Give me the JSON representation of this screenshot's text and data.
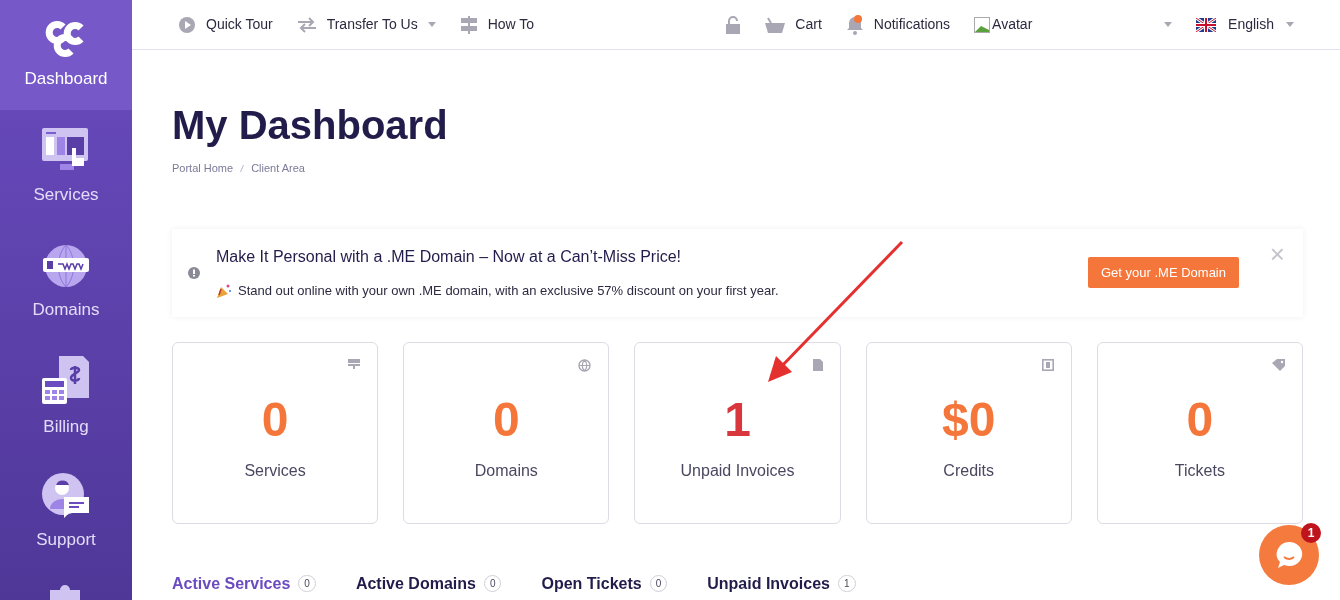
{
  "sidebar": {
    "items": [
      {
        "label": "Dashboard",
        "selected": true
      },
      {
        "label": "Services",
        "selected": false
      },
      {
        "label": "Domains",
        "selected": false
      },
      {
        "label": "Billing",
        "selected": false
      },
      {
        "label": "Support",
        "selected": false
      }
    ]
  },
  "topbar": {
    "left": [
      {
        "label": "Quick Tour",
        "dropdown": false
      },
      {
        "label": "Transfer To Us",
        "dropdown": true
      },
      {
        "label": "How To",
        "dropdown": false
      }
    ],
    "right": [
      {
        "label": "Cart"
      },
      {
        "label": "Notifications"
      }
    ],
    "avatar_alt": "Avatar",
    "language": "English"
  },
  "page": {
    "title": "My Dashboard",
    "breadcrumb": [
      "Portal Home",
      "Client Area"
    ]
  },
  "banner": {
    "title": "Make It Personal with a .ME Domain – Now at a Can’t-Miss Price!",
    "text": "Stand out online with your own .ME domain, with an exclusive 57% discount on your first year.",
    "button": "Get your .ME Domain",
    "close": "×"
  },
  "stats": [
    {
      "value": "0",
      "label": "Services",
      "color": "#f5763a"
    },
    {
      "value": "0",
      "label": "Domains",
      "color": "#f5763a"
    },
    {
      "value": "1",
      "label": "Unpaid Invoices",
      "color": "#d9363e"
    },
    {
      "value": "$0",
      "label": "Credits",
      "color": "#f5763a"
    },
    {
      "value": "0",
      "label": "Tickets",
      "color": "#f5763a"
    }
  ],
  "tabs": [
    {
      "label": "Active Services",
      "count": "0",
      "selected": true
    },
    {
      "label": "Active Domains",
      "count": "0",
      "selected": false
    },
    {
      "label": "Open Tickets",
      "count": "0",
      "selected": false
    },
    {
      "label": "Unpaid Invoices",
      "count": "1",
      "selected": false
    }
  ],
  "chat": {
    "badge": "1"
  }
}
